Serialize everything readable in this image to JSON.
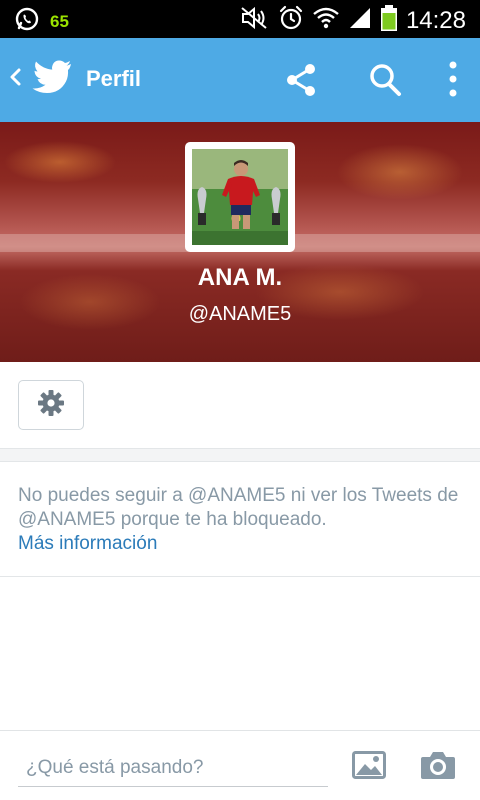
{
  "status_bar": {
    "badge": "65",
    "time": "14:28"
  },
  "action_bar": {
    "title": "Perfil"
  },
  "profile": {
    "name": "ANA M.",
    "handle": "@ANAME5"
  },
  "blocked": {
    "message": "No puedes seguir a @ANAME5 ni ver los Tweets de @ANAME5 porque te ha bloqueado.",
    "link": "Más información"
  },
  "compose": {
    "placeholder": "¿Qué está pasando?"
  },
  "colors": {
    "accent": "#4eaae5",
    "link": "#2b7bb9",
    "muted_text": "#8899a6"
  }
}
